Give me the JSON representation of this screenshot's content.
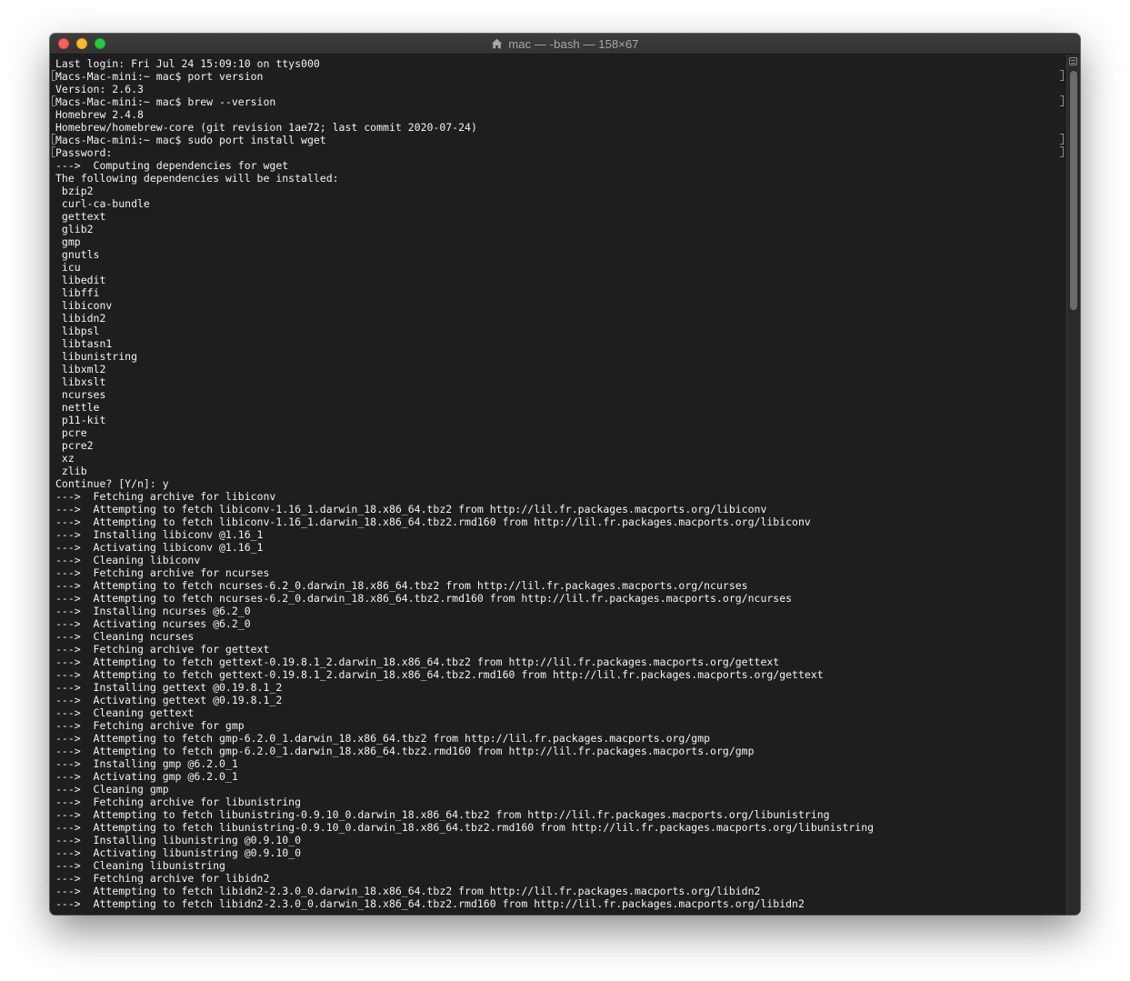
{
  "window": {
    "title": "mac — -bash — 158×67"
  },
  "icons": {
    "title": "home-icon",
    "scroll": "scroll-menu-icon"
  },
  "colors": {
    "background": "#1e1e1e",
    "text": "#f2f2f2",
    "close": "#fe5f57",
    "minimize": "#febc2e",
    "maximize": "#28c840"
  },
  "terminal": {
    "lines": [
      "Last login: Fri Jul 24 15:09:10 on ttys000",
      "Macs-Mac-mini:~ mac$ port version",
      "Version: 2.6.3",
      "Macs-Mac-mini:~ mac$ brew --version",
      "Homebrew 2.4.8",
      "Homebrew/homebrew-core (git revision 1ae72; last commit 2020-07-24)",
      "Macs-Mac-mini:~ mac$ sudo port install wget",
      "Password:",
      "--->  Computing dependencies for wget",
      "The following dependencies will be installed:",
      " bzip2",
      " curl-ca-bundle",
      " gettext",
      " glib2",
      " gmp",
      " gnutls",
      " icu",
      " libedit",
      " libffi",
      " libiconv",
      " libidn2",
      " libpsl",
      " libtasn1",
      " libunistring",
      " libxml2",
      " libxslt",
      " ncurses",
      " nettle",
      " p11-kit",
      " pcre",
      " pcre2",
      " xz",
      " zlib",
      "Continue? [Y/n]: y",
      "--->  Fetching archive for libiconv",
      "--->  Attempting to fetch libiconv-1.16_1.darwin_18.x86_64.tbz2 from http://lil.fr.packages.macports.org/libiconv",
      "--->  Attempting to fetch libiconv-1.16_1.darwin_18.x86_64.tbz2.rmd160 from http://lil.fr.packages.macports.org/libiconv",
      "--->  Installing libiconv @1.16_1",
      "--->  Activating libiconv @1.16_1",
      "--->  Cleaning libiconv",
      "--->  Fetching archive for ncurses",
      "--->  Attempting to fetch ncurses-6.2_0.darwin_18.x86_64.tbz2 from http://lil.fr.packages.macports.org/ncurses",
      "--->  Attempting to fetch ncurses-6.2_0.darwin_18.x86_64.tbz2.rmd160 from http://lil.fr.packages.macports.org/ncurses",
      "--->  Installing ncurses @6.2_0",
      "--->  Activating ncurses @6.2_0",
      "--->  Cleaning ncurses",
      "--->  Fetching archive for gettext",
      "--->  Attempting to fetch gettext-0.19.8.1_2.darwin_18.x86_64.tbz2 from http://lil.fr.packages.macports.org/gettext",
      "--->  Attempting to fetch gettext-0.19.8.1_2.darwin_18.x86_64.tbz2.rmd160 from http://lil.fr.packages.macports.org/gettext",
      "--->  Installing gettext @0.19.8.1_2",
      "--->  Activating gettext @0.19.8.1_2",
      "--->  Cleaning gettext",
      "--->  Fetching archive for gmp",
      "--->  Attempting to fetch gmp-6.2.0_1.darwin_18.x86_64.tbz2 from http://lil.fr.packages.macports.org/gmp",
      "--->  Attempting to fetch gmp-6.2.0_1.darwin_18.x86_64.tbz2.rmd160 from http://lil.fr.packages.macports.org/gmp",
      "--->  Installing gmp @6.2.0_1",
      "--->  Activating gmp @6.2.0_1",
      "--->  Cleaning gmp",
      "--->  Fetching archive for libunistring",
      "--->  Attempting to fetch libunistring-0.9.10_0.darwin_18.x86_64.tbz2 from http://lil.fr.packages.macports.org/libunistring",
      "--->  Attempting to fetch libunistring-0.9.10_0.darwin_18.x86_64.tbz2.rmd160 from http://lil.fr.packages.macports.org/libunistring",
      "--->  Installing libunistring @0.9.10_0",
      "--->  Activating libunistring @0.9.10_0",
      "--->  Cleaning libunistring",
      "--->  Fetching archive for libidn2",
      "--->  Attempting to fetch libidn2-2.3.0_0.darwin_18.x86_64.tbz2 from http://lil.fr.packages.macports.org/libidn2",
      "--->  Attempting to fetch libidn2-2.3.0_0.darwin_18.x86_64.tbz2.rmd160 from http://lil.fr.packages.macports.org/libidn2"
    ]
  }
}
